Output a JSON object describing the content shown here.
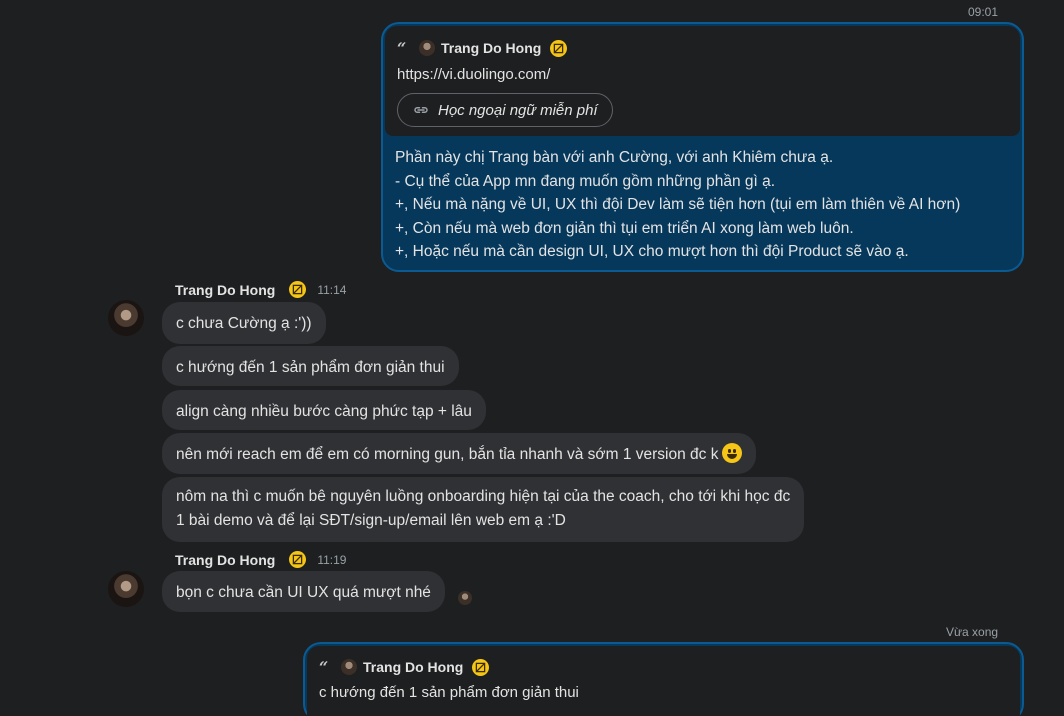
{
  "top_time": "09:01",
  "out1": {
    "quote": {
      "name": "Trang Do Hong",
      "link_url": "https://vi.duolingo.com/",
      "link_title": "Học ngoại ngữ miễn phí"
    },
    "text": "Phần này chị Trang bàn với anh Cường, với anh Khiêm chưa ạ.\n- Cụ thể của App mn đang muốn gồm những phần gì ạ.\n+, Nếu mà nặng về UI, UX thì đội Dev làm sẽ tiện hơn (tụi em làm thiên về AI hơn)\n+, Còn nếu mà web đơn giản thì tụi em triển AI xong làm web luôn.\n+, Hoặc nếu mà cần design UI, UX cho mượt hơn thì đội Product sẽ vào ạ."
  },
  "group1": {
    "sender": "Trang Do Hong",
    "time": "11:14",
    "messages": [
      "c chưa Cường ạ :'))",
      "c hướng đến 1 sản phẩm đơn giản thui",
      "align càng nhiều bước càng phức tạp + lâu",
      "nên mới reach em để em có morning gun, bắn tỉa nhanh và sớm 1 version đc k",
      "nôm na thì c muốn bê nguyên luồng onboarding hiện tại của the coach, cho tới khi học đc\n1 bài demo và để lại SĐT/sign-up/email lên web em ạ :'D"
    ]
  },
  "group2": {
    "sender": "Trang Do Hong",
    "time": "11:19",
    "messages": [
      "bọn c chưa cần UI UX quá mượt nhé"
    ]
  },
  "out2": {
    "time": "Vừa xong",
    "quote_name": "Trang Do Hong",
    "quote_text": "c hướng đến 1 sản phẩm đơn giản thui"
  },
  "icons": {
    "quote": "quote-icon",
    "bot": "bot-badge-icon",
    "link": "link-icon",
    "emoji": "grinning-emoji-icon"
  },
  "colors": {
    "background": "#1e1f20",
    "outgoing_bubble": "#06385c",
    "outgoing_border": "#0b5a91",
    "incoming_bubble": "#303134",
    "badge": "#f5c518"
  }
}
